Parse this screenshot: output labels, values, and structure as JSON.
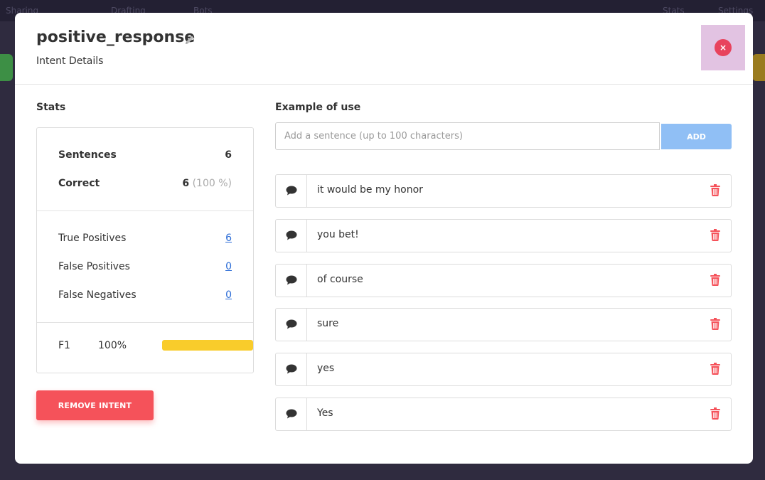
{
  "background": {
    "nav_items": [
      "Sharing",
      "Drafting",
      "Bots",
      "Stats",
      "Settings"
    ]
  },
  "modal": {
    "title": "positive_response",
    "subtitle": "Intent Details",
    "close_label": "×"
  },
  "stats": {
    "heading": "Stats",
    "sentences_label": "Sentences",
    "sentences_value": "6",
    "correct_label": "Correct",
    "correct_value": "6",
    "correct_percent": "(100 %)",
    "true_positives_label": "True Positives",
    "true_positives_value": "6",
    "false_positives_label": "False Positives",
    "false_positives_value": "0",
    "false_negatives_label": "False Negatives",
    "false_negatives_value": "0",
    "f1_label": "F1",
    "f1_value": "100%",
    "f1_fraction": 1.0,
    "f1_bar_color": "#f9cc2b"
  },
  "remove_button": "REMOVE INTENT",
  "examples": {
    "heading": "Example of use",
    "input_placeholder": "Add a sentence (up to 100 characters)",
    "add_button": "ADD",
    "sentences": [
      "it would be my honor",
      "you bet!",
      "of course",
      "sure",
      "yes",
      "Yes"
    ]
  },
  "colors": {
    "danger": "#f5525a",
    "accent_blue": "#90bff5",
    "link": "#2a6bd6",
    "close": "#e8435d"
  }
}
